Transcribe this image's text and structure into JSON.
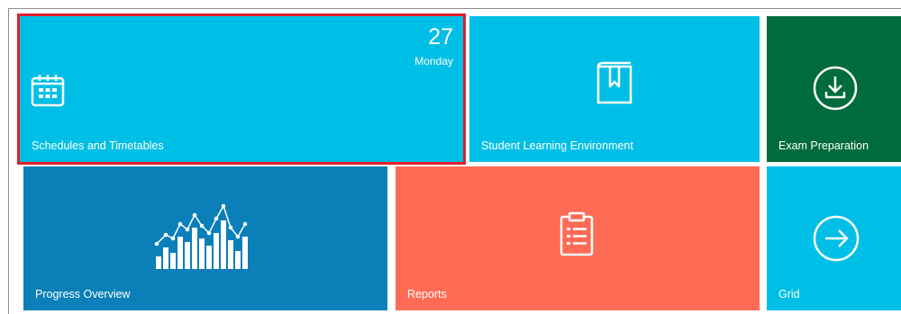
{
  "tiles": {
    "schedules": {
      "label": "Schedules and Timetables",
      "date_number": "27",
      "date_day": "Monday",
      "icon": "calendar-icon",
      "color": "#00bfe6",
      "selected": true
    },
    "sle": {
      "label": "Student Learning Environment",
      "icon": "book-icon",
      "color": "#00bfe6"
    },
    "exam": {
      "label": "Exam Preparation",
      "icon": "download-circle-icon",
      "color": "#006b3c"
    },
    "progress": {
      "label": "Progress Overview",
      "icon": "bar-line-chart-icon",
      "color": "#0a7fb8"
    },
    "reports": {
      "label": "Reports",
      "icon": "clipboard-list-icon",
      "color": "#ff6b55"
    },
    "grid": {
      "label": "Grid",
      "icon": "arrow-right-circle-icon",
      "color": "#00bfe6"
    }
  },
  "selection_color": "#e0202e"
}
